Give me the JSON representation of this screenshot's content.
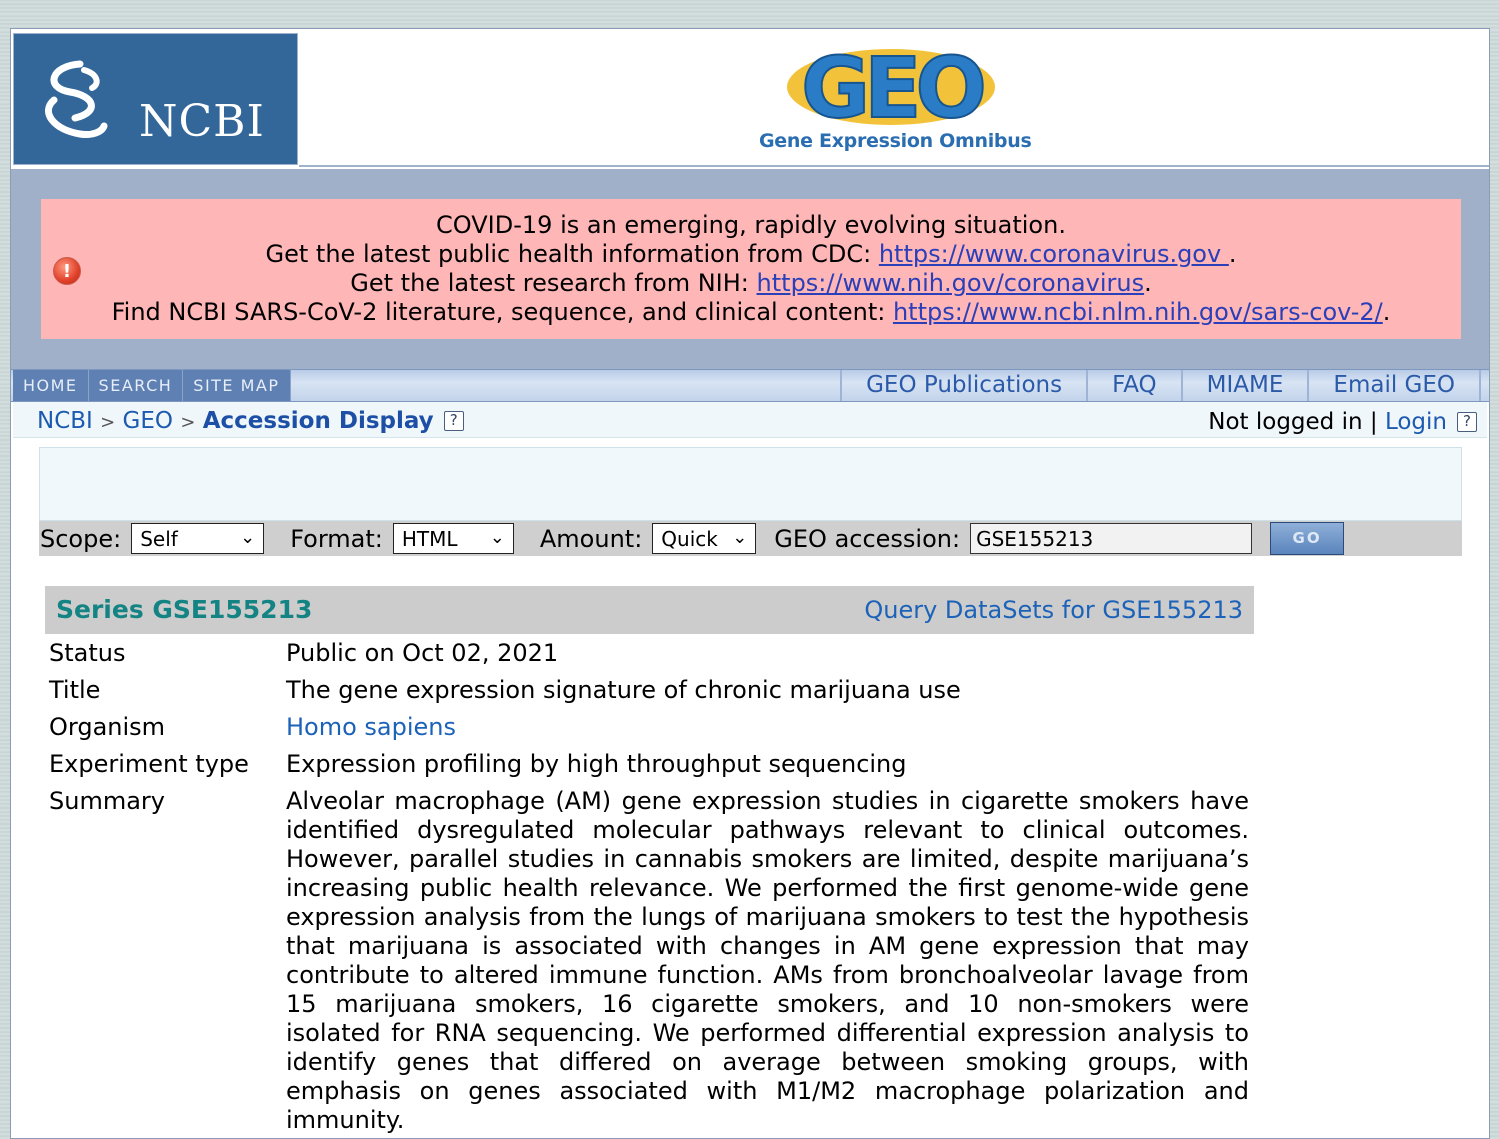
{
  "header": {
    "ncbi_label": "NCBI",
    "geo_logo_text": "GEO",
    "geo_subtitle": "Gene Expression Omnibus"
  },
  "covid_banner": {
    "line1": "COVID-19 is an emerging, rapidly evolving situation.",
    "line2_prefix": "Get the latest public health information from CDC: ",
    "line2_link": "https://www.coronavirus.gov ",
    "line3_prefix": "Get the latest research from NIH: ",
    "line3_link": "https://www.nih.gov/coronavirus",
    "line4_prefix": "Find NCBI SARS-CoV-2 literature, sequence, and clinical content: ",
    "line4_link": "https://www.ncbi.nlm.nih.gov/sars-cov-2/",
    "period": "."
  },
  "nav": {
    "left": [
      "HOME",
      "SEARCH",
      "SITE MAP"
    ],
    "right": [
      "GEO Publications",
      "FAQ",
      "MIAME",
      "Email GEO"
    ]
  },
  "breadcrumb": {
    "ncbi": "NCBI",
    "geo": "GEO",
    "sep": ">",
    "current": "Accession Display",
    "help": "?",
    "login_status": "Not logged in",
    "divider": "|",
    "login_link": "Login"
  },
  "form": {
    "scope_label": "Scope:",
    "scope_value": "Self",
    "format_label": "Format:",
    "format_value": "HTML",
    "amount_label": "Amount:",
    "amount_value": "Quick",
    "accession_label": "GEO accession:",
    "accession_value": "GSE155213",
    "go_label": "GO"
  },
  "series": {
    "title": "Series GSE155213",
    "query_link": "Query DataSets for GSE155213",
    "fields": {
      "status_k": "Status",
      "status_v": "Public on Oct 02, 2021",
      "title_k": "Title",
      "title_v": "The gene expression signature of chronic marijuana use",
      "organism_k": "Organism",
      "organism_v": "Homo sapiens",
      "exp_k": "Experiment type",
      "exp_v": "Expression profiling by high throughput sequencing",
      "summary_k": "Summary",
      "summary_v": "Alveolar macrophage (AM) gene expression studies in cigarette smokers have identified dysregulated molecular pathways relevant to clinical outcomes. However, parallel studies in cannabis smokers are limited, despite marijuana’s increasing public health relevance. We performed the first genome-wide gene expression analysis from the lungs of marijuana smokers to test the hypothesis that marijuana is associated with changes in AM gene expression that may contribute to altered immune function. AMs from bronchoalveolar lavage from 15 marijuana smokers, 16 cigarette smokers, and 10 non-smokers were isolated for RNA sequencing. We performed differential expression analysis to identify genes that differed on average between smoking groups, with emphasis on genes associated with M1/M2 macrophage polarization and immunity."
    }
  },
  "colors": {
    "ncbi_blue": "#336699",
    "band": "#9fb0c8",
    "covid_bg": "#ffb6b6",
    "series_title": "#148383",
    "link": "#1c62b8"
  }
}
